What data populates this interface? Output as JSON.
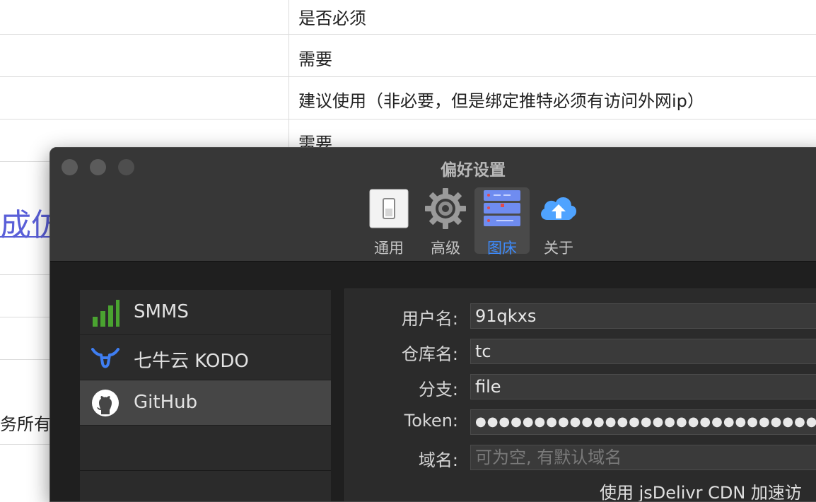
{
  "background_page": {
    "rows": [
      {
        "right_text": "是否必须"
      },
      {
        "right_text": "需要"
      },
      {
        "right_text": "建议使用（非必要，但是绑定推特必须有访问外网ip）"
      },
      {
        "right_text": "需要"
      }
    ],
    "partial_link": "成仿",
    "partial_text": "务所有"
  },
  "window": {
    "title": "偏好设置",
    "toolbar": [
      {
        "label": "通用",
        "icon": "switch-icon"
      },
      {
        "label": "高级",
        "icon": "gear-icon"
      },
      {
        "label": "图床",
        "icon": "server-icon",
        "selected": true
      },
      {
        "label": "关于",
        "icon": "cloud-upload-icon"
      }
    ],
    "sidebar": [
      {
        "label": "SMMS",
        "icon": "signal-bars-icon"
      },
      {
        "label": "七牛云 KODO",
        "icon": "qiniu-icon"
      },
      {
        "label": "GitHub",
        "icon": "github-icon",
        "selected": true
      }
    ],
    "form": {
      "username_label": "用户名:",
      "username_value": "91qkxs",
      "repo_label": "仓库名:",
      "repo_value": "tc",
      "branch_label": "分支:",
      "branch_value": "file",
      "token_label": "Token:",
      "token_value": "●●●●●●●●●●●●●●●●●●●●●●●●●●●●●●●●●●●●●●●●",
      "domain_label": "域名:",
      "domain_placeholder": "可为空, 有默认域名",
      "cdn_text": "使用 jsDelivr CDN 加速访"
    },
    "accent_color": "#3d8cff"
  }
}
